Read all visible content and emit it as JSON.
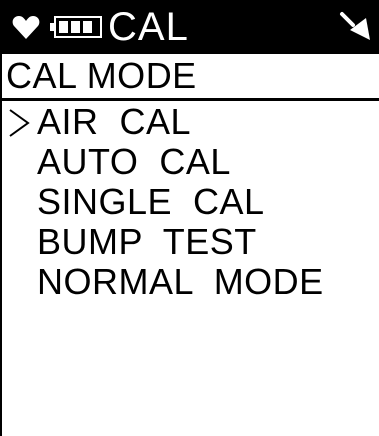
{
  "header": {
    "title": "CAL",
    "icons": {
      "status": "heart-icon",
      "battery": "battery-icon",
      "alert": "beep-icon"
    }
  },
  "subtitle": "CAL MODE",
  "menu": {
    "cursor_icon": "chevron-right-icon",
    "selected_index": 0,
    "items": [
      {
        "label": "AIR  CAL"
      },
      {
        "label": "AUTO  CAL"
      },
      {
        "label": "SINGLE  CAL"
      },
      {
        "label": "BUMP  TEST"
      },
      {
        "label": "NORMAL  MODE"
      }
    ]
  },
  "colors": {
    "background": "#ffffff",
    "foreground": "#000000"
  }
}
